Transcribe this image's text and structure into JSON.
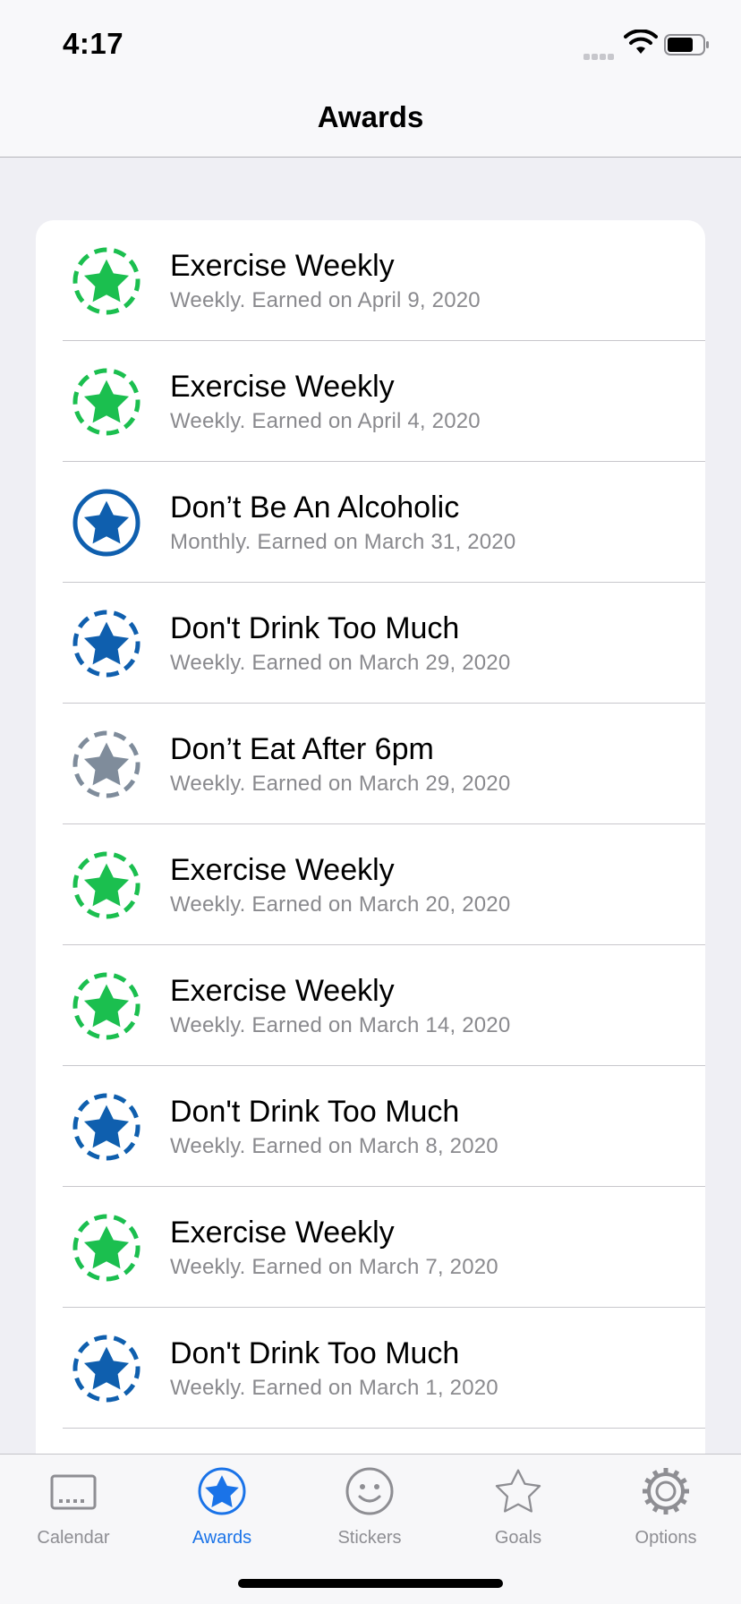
{
  "status_bar": {
    "time": "4:17"
  },
  "nav": {
    "title": "Awards"
  },
  "colors": {
    "green": "#1bbf4f",
    "blue": "#0f5fae",
    "gray": "#7f8c9b",
    "tab_active": "#1a73e8",
    "tab_inactive": "#8e8e93"
  },
  "awards": [
    {
      "title": "Exercise Weekly",
      "subtitle": "Weekly. Earned on April 9, 2020",
      "badge": "green-dashed-star-icon"
    },
    {
      "title": "Exercise Weekly",
      "subtitle": "Weekly. Earned on April 4, 2020",
      "badge": "green-dashed-star-icon"
    },
    {
      "title": "Don’t Be An Alcoholic",
      "subtitle": "Monthly. Earned on March 31, 2020",
      "badge": "blue-solid-star-icon"
    },
    {
      "title": "Don't Drink Too Much",
      "subtitle": "Weekly. Earned on March 29, 2020",
      "badge": "blue-dashed-star-icon"
    },
    {
      "title": "Don’t Eat After 6pm",
      "subtitle": "Weekly. Earned on March 29, 2020",
      "badge": "gray-dashed-star-icon"
    },
    {
      "title": "Exercise Weekly",
      "subtitle": "Weekly. Earned on March 20, 2020",
      "badge": "green-dashed-star-icon"
    },
    {
      "title": "Exercise Weekly",
      "subtitle": "Weekly. Earned on March 14, 2020",
      "badge": "green-dashed-star-icon"
    },
    {
      "title": "Don't Drink Too Much",
      "subtitle": "Weekly. Earned on March 8, 2020",
      "badge": "blue-dashed-star-icon"
    },
    {
      "title": "Exercise Weekly",
      "subtitle": "Weekly. Earned on March 7, 2020",
      "badge": "green-dashed-star-icon"
    },
    {
      "title": "Don't Drink Too Much",
      "subtitle": "Weekly. Earned on March 1, 2020",
      "badge": "blue-dashed-star-icon"
    }
  ],
  "tabs": [
    {
      "label": "Calendar",
      "icon": "calendar-icon",
      "active": false
    },
    {
      "label": "Awards",
      "icon": "star-circle-icon",
      "active": true
    },
    {
      "label": "Stickers",
      "icon": "smiley-icon",
      "active": false
    },
    {
      "label": "Goals",
      "icon": "star-outline-icon",
      "active": false
    },
    {
      "label": "Options",
      "icon": "gear-icon",
      "active": false
    }
  ]
}
